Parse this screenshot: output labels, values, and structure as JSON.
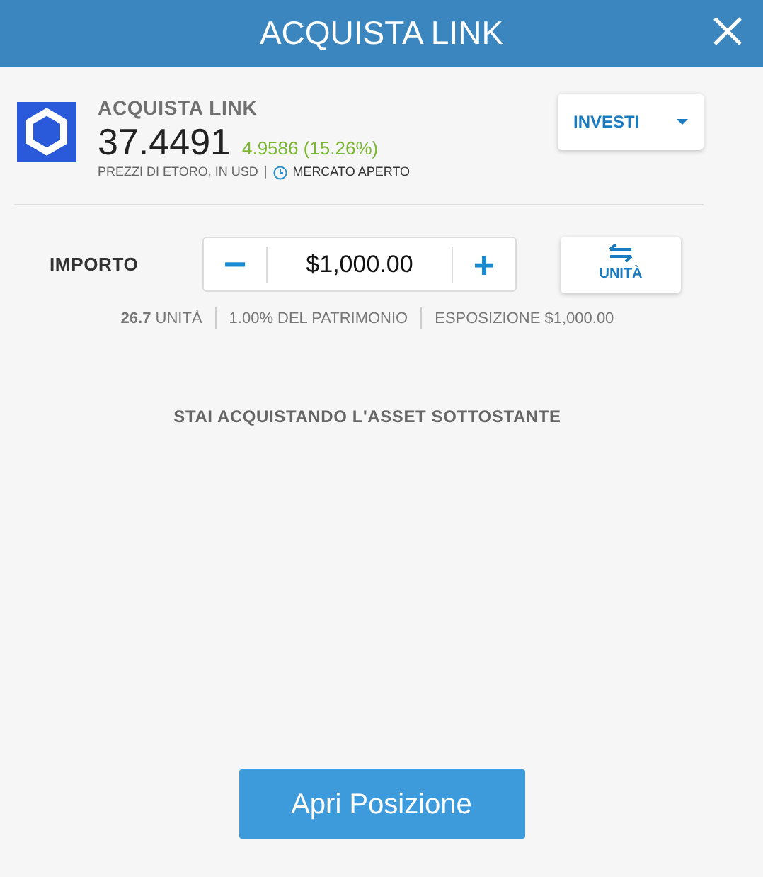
{
  "window": {
    "title": "ACQUISTA LINK"
  },
  "asset": {
    "heading": "ACQUISTA **LINK**",
    "price": "37.4491",
    "change": "4.9586 (15.26%)",
    "source": "PREZZI DI ETORO, IN USD",
    "separator": "|",
    "market_status": "MERCATO APERTO"
  },
  "mode_dropdown": {
    "label": "INVESTI"
  },
  "amount": {
    "label": "IMPORTO",
    "value": "$1,000.00",
    "minus": "−",
    "plus": "+",
    "toggle_label": "UNITÀ"
  },
  "info": [
    "**26.7** UNITÀ",
    "1.00% DEL PATRIMONIO",
    "ESPOSIZIONE $1,000.00"
  ],
  "notice": "STAI ACQUISTANDO L'ASSET SOTTOSTANTE",
  "submit": "Apri Posizione"
}
